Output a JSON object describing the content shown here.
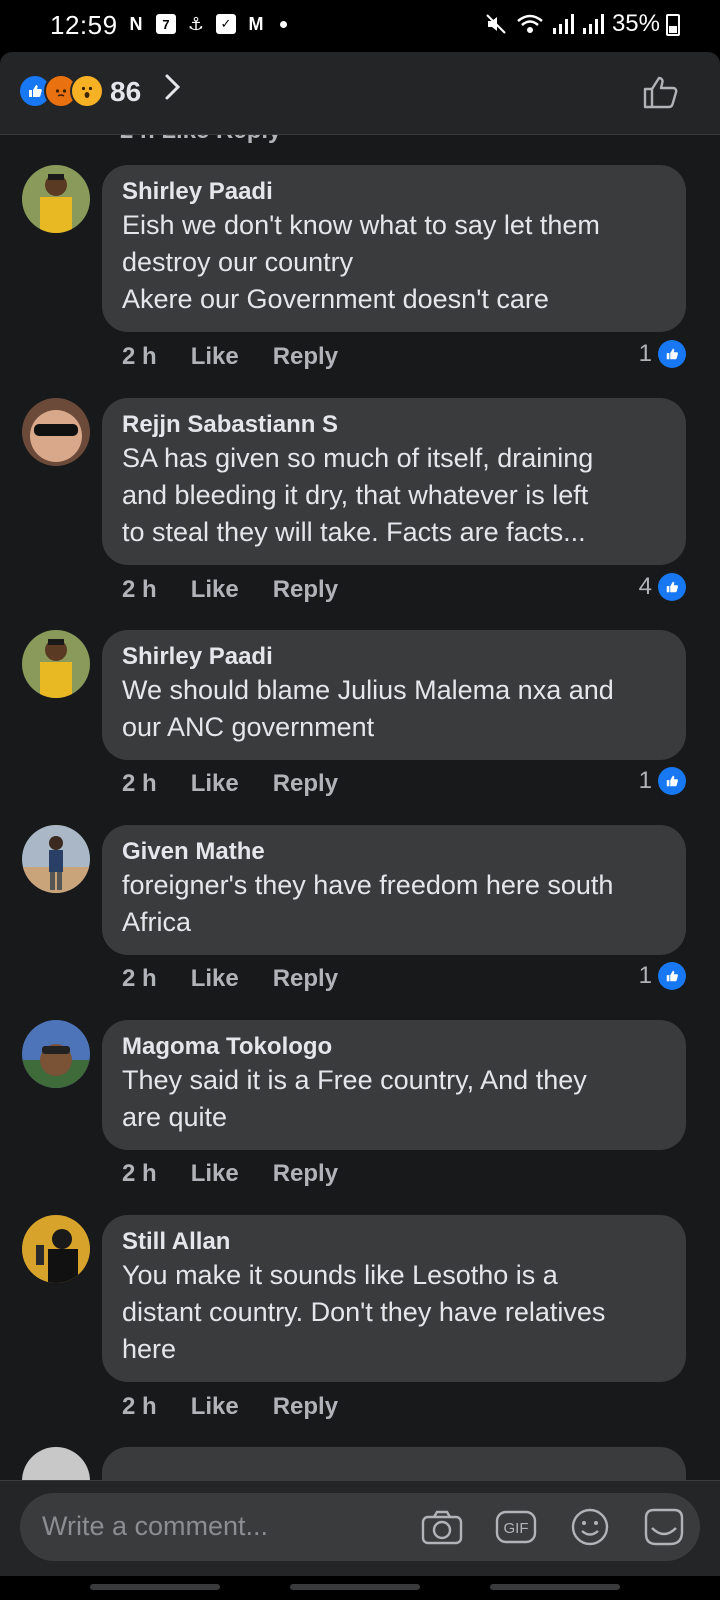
{
  "status_bar": {
    "time": "12:59",
    "battery": "35%",
    "left_icons": [
      "netflix-icon",
      "calendar-icon",
      "app-icon",
      "checkbox-icon",
      "gmail-icon",
      "dot-icon"
    ],
    "right_icons": [
      "mute-icon",
      "wifi-icon",
      "signal-icon",
      "signal-icon",
      "battery-icon"
    ]
  },
  "header": {
    "reaction_count": "86",
    "reactions": [
      "like",
      "angry",
      "wow"
    ]
  },
  "clipped_row_text": "2 h    Like    Reply",
  "comments": [
    {
      "author": "Shirley Paadi",
      "lines": [
        "Eish we don't know what to say let them",
        "destroy our country",
        "Akere our Government doesn't care"
      ],
      "time": "2 h",
      "like_label": "Like",
      "reply_label": "Reply",
      "likes": "1"
    },
    {
      "author": "Rejjn Sabastiann S",
      "lines": [
        "SA has given so much of itself, draining",
        "and bleeding it dry, that whatever is left",
        "to steal they will take. Facts are facts..."
      ],
      "time": "2 h",
      "like_label": "Like",
      "reply_label": "Reply",
      "likes": "4"
    },
    {
      "author": "Shirley Paadi",
      "lines": [
        "We should blame Julius Malema nxa and",
        "our ANC government"
      ],
      "time": "2 h",
      "like_label": "Like",
      "reply_label": "Reply",
      "likes": "1"
    },
    {
      "author": "Given Mathe",
      "lines": [
        "foreigner's they have freedom here south",
        "Africa"
      ],
      "time": "2 h",
      "like_label": "Like",
      "reply_label": "Reply",
      "likes": "1"
    },
    {
      "author": "Magoma Tokologo",
      "lines": [
        "They said it is a Free country, And they",
        "are quite"
      ],
      "time": "2 h",
      "like_label": "Like",
      "reply_label": "Reply",
      "likes": ""
    },
    {
      "author": "Still Allan",
      "lines": [
        "You make it sounds like Lesotho is a",
        "distant country. Don't they have relatives",
        "here"
      ],
      "time": "2 h",
      "like_label": "Like",
      "reply_label": "Reply",
      "likes": ""
    }
  ],
  "composer": {
    "placeholder": "Write a comment...",
    "tools": [
      "camera-icon",
      "gif-icon",
      "emoji-icon",
      "sticker-icon"
    ]
  },
  "colors": {
    "background": "#18191a",
    "bubble": "#3a3b3c",
    "accent": "#1877f2",
    "text_primary": "#e4e6eb",
    "text_secondary": "#b0b3b8"
  }
}
